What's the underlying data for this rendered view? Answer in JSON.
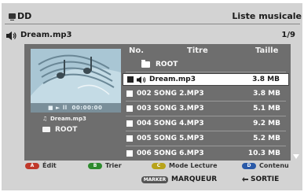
{
  "header": {
    "source": "DD",
    "title": "Liste musicale"
  },
  "file_bar": {
    "current_file": "Dream.mp3",
    "page": "1/9"
  },
  "preview": {
    "playback_time": "00:00:00"
  },
  "info": {
    "track": "Dream.mp3",
    "folder": "ROOT"
  },
  "columns": {
    "no": "No.",
    "title": "Titre",
    "size": "Taille"
  },
  "list": {
    "folder": {
      "label": "ROOT"
    },
    "items": [
      {
        "label": "Dream.mp3",
        "size": "3.8 MB",
        "selected": true
      },
      {
        "label": "002  SONG 2.MP3",
        "size": "3.8 MB"
      },
      {
        "label": "003  SONG 3.MP3",
        "size": "5.1 MB"
      },
      {
        "label": "004  SONG 4.MP3",
        "size": "9.2 MB"
      },
      {
        "label": "005  SONG 5.MP3",
        "size": "5.2 MB"
      },
      {
        "label": "006  SONG 6.MP3",
        "size": "10.3 MB"
      }
    ]
  },
  "footer": {
    "a_key": "A",
    "a_label": "Édit",
    "b_key": "B",
    "b_label": "Trier",
    "c_key": "C",
    "c_label": "Mode Lecture",
    "d_key": "D",
    "d_label": "Contenu"
  },
  "bottom": {
    "marker_key": "MARKER",
    "marker_label": "MARQUEUR",
    "return_label": "SORTIE"
  },
  "colors": {
    "panel": "#6e6e6e",
    "background": "#d3d3d3",
    "key_a": "#c0392b",
    "key_b": "#2e8b2e",
    "key_c": "#b8a31a",
    "key_d": "#2a5aa8"
  }
}
